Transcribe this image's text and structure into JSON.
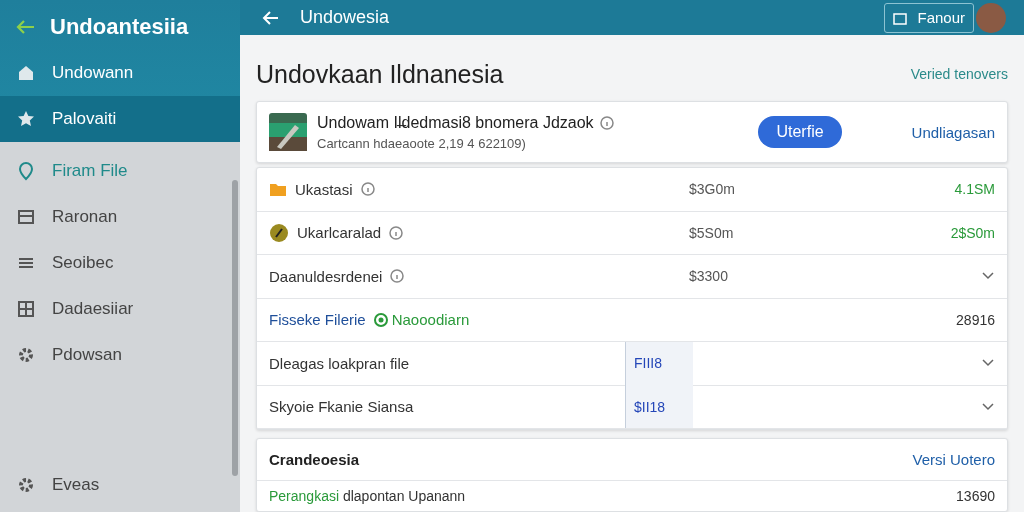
{
  "sidebar": {
    "title": "Undoantesiia",
    "items": [
      {
        "label": "Undowann",
        "selected": false,
        "active": false
      },
      {
        "label": "Palovaiti",
        "selected": true,
        "active": false
      },
      {
        "label": "Firam File",
        "selected": false,
        "active": true
      },
      {
        "label": "Raronan",
        "selected": false,
        "active": false
      },
      {
        "label": "Seoibec",
        "selected": false,
        "active": false
      },
      {
        "label": "Dadaesiiar",
        "selected": false,
        "active": false
      },
      {
        "label": "Pdowsan",
        "selected": false,
        "active": false
      }
    ],
    "footer": {
      "label": "Eveas"
    }
  },
  "topbar": {
    "title": "Undowesia",
    "button": "Fanour"
  },
  "page": {
    "title": "Undovkaan Ildnanesia",
    "link": "Veried tenovers"
  },
  "product": {
    "name": "Undowam Il̶dedmasi8 bnomera Jdzaok",
    "subtitle": "Cartcann hdaeaoote 2,19 4 622109)",
    "button": "Uterfie",
    "link": "Undliagasan"
  },
  "rows": [
    {
      "kind": "amount",
      "label": "Ukastasi",
      "amount": "$3G0m",
      "change": "4.1SM"
    },
    {
      "kind": "amount",
      "label": "Ukarlcaralad",
      "amount": "$5S0m",
      "change": "2$S0m"
    },
    {
      "kind": "expand",
      "label": "Daanuldesrdenei",
      "amount": "$3300"
    },
    {
      "kind": "status",
      "label": "Fisseke Filerie",
      "status": "Naooodiarn",
      "value": "28916"
    },
    {
      "kind": "field",
      "label": "Dleagas loakpran file",
      "value": "FIII8"
    },
    {
      "kind": "field",
      "label": "Skyoie Fkanie Siansa",
      "value": "$II18"
    }
  ],
  "section": {
    "title": "Crandeoesia",
    "link": "Versi Uotero",
    "row": {
      "lead": "Perangkasi",
      "rest": "dlapontan Upanann",
      "value": "13690"
    }
  }
}
